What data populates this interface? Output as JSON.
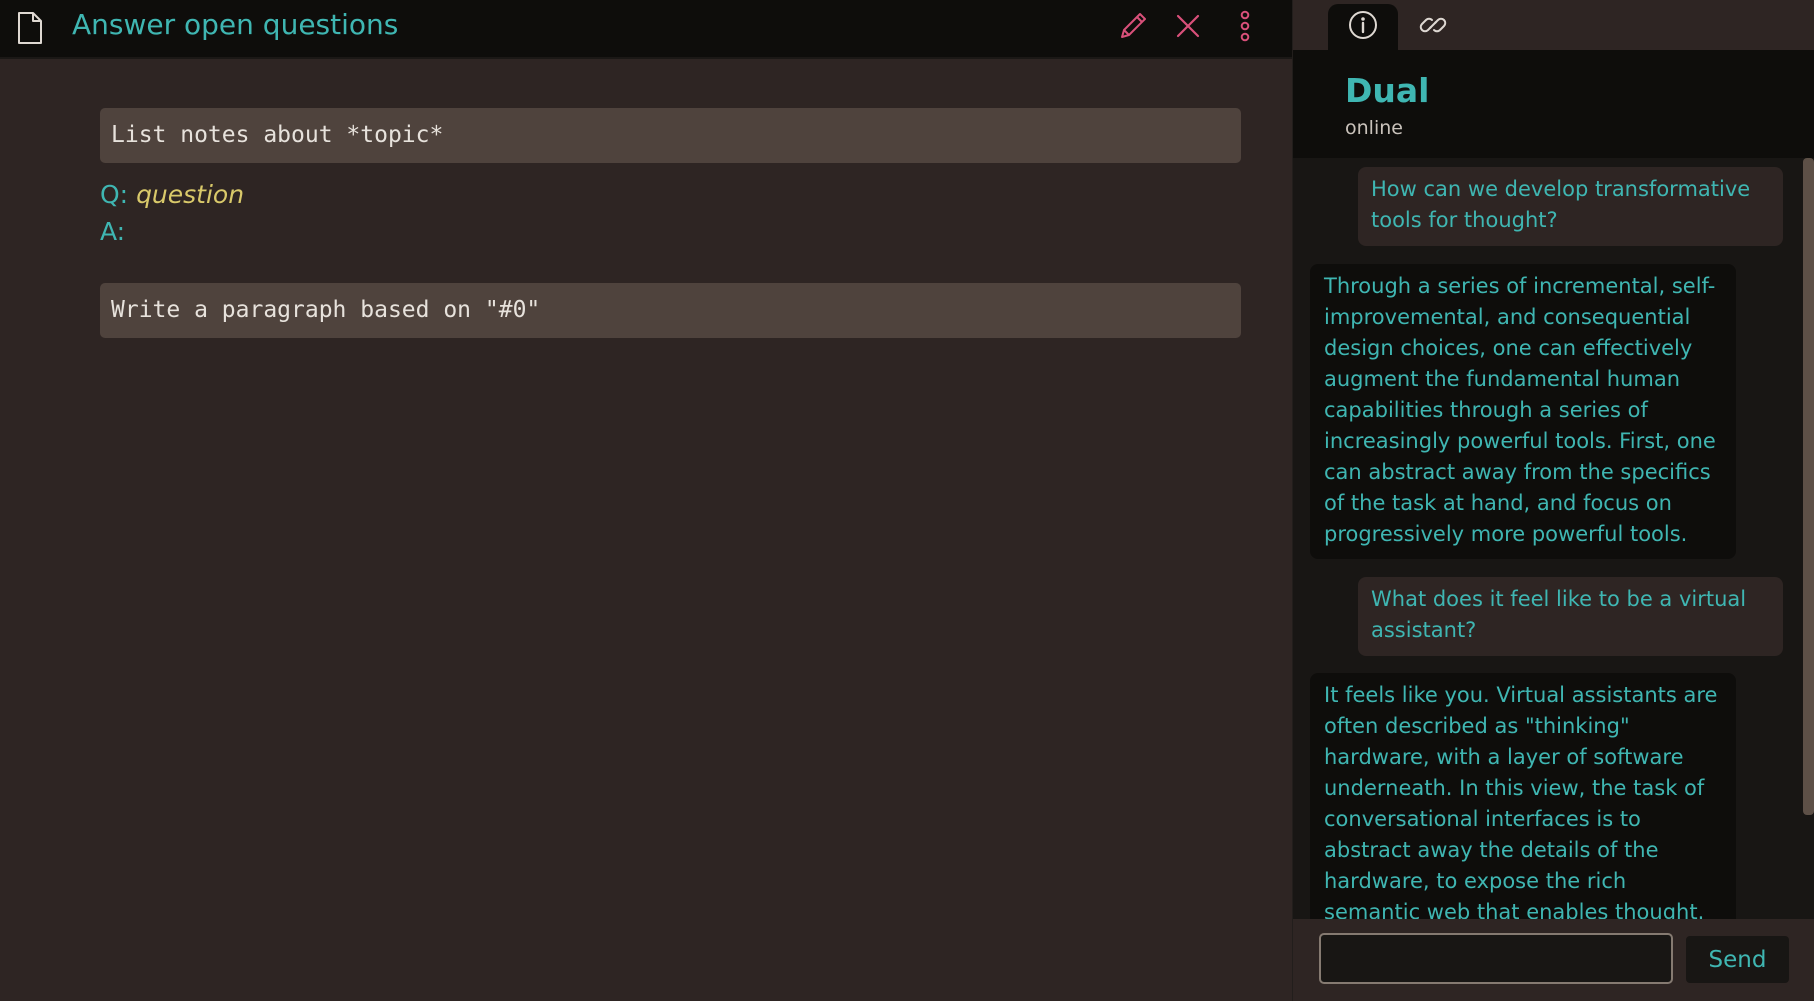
{
  "colors": {
    "accent": "#3fb6b2",
    "icon_accent": "#d9507a",
    "question_value": "#d9c96a",
    "background": "#2e2523",
    "panel_dark": "#0e0d0b"
  },
  "document": {
    "icon": "document-icon",
    "title": "Answer open questions",
    "toolbar": {
      "edit_icon": "pencil-icon",
      "close_icon": "close-icon",
      "more_icon": "kebab-menu-icon"
    },
    "blocks": {
      "prompt1": "List notes about *topic*",
      "q_label": "Q: ",
      "q_value": "question",
      "a_label": "A:",
      "prompt2": "Write a paragraph based on \"#0\""
    }
  },
  "sidebar": {
    "tabs": [
      {
        "icon": "info-icon",
        "active": true
      },
      {
        "icon": "link-icon",
        "active": false
      }
    ],
    "agent": {
      "name": "Dual",
      "status": "online"
    },
    "messages": [
      {
        "role": "user",
        "text": "How can we develop transformative tools for thought?"
      },
      {
        "role": "agent",
        "text": "Through a series of incremental, self-improvemental, and consequential design choices, one can effectively augment the fundamental human capabilities through a series of increasingly powerful tools. First, one can abstract away from the specifics of the task at hand, and focus on progressively more powerful tools."
      },
      {
        "role": "user",
        "text": "What does it feel like to be a virtual assistant?"
      },
      {
        "role": "agent",
        "text": "It feels like you. Virtual assistants are often described as \"thinking\" hardware, with a layer of software underneath. In this view, the task of conversational interfaces is to abstract away the details of the hardware, to expose the rich semantic web that enables thought. Ask someone to paint you a picture of"
      }
    ],
    "input": {
      "value": "",
      "placeholder": ""
    },
    "send_label": "Send"
  }
}
